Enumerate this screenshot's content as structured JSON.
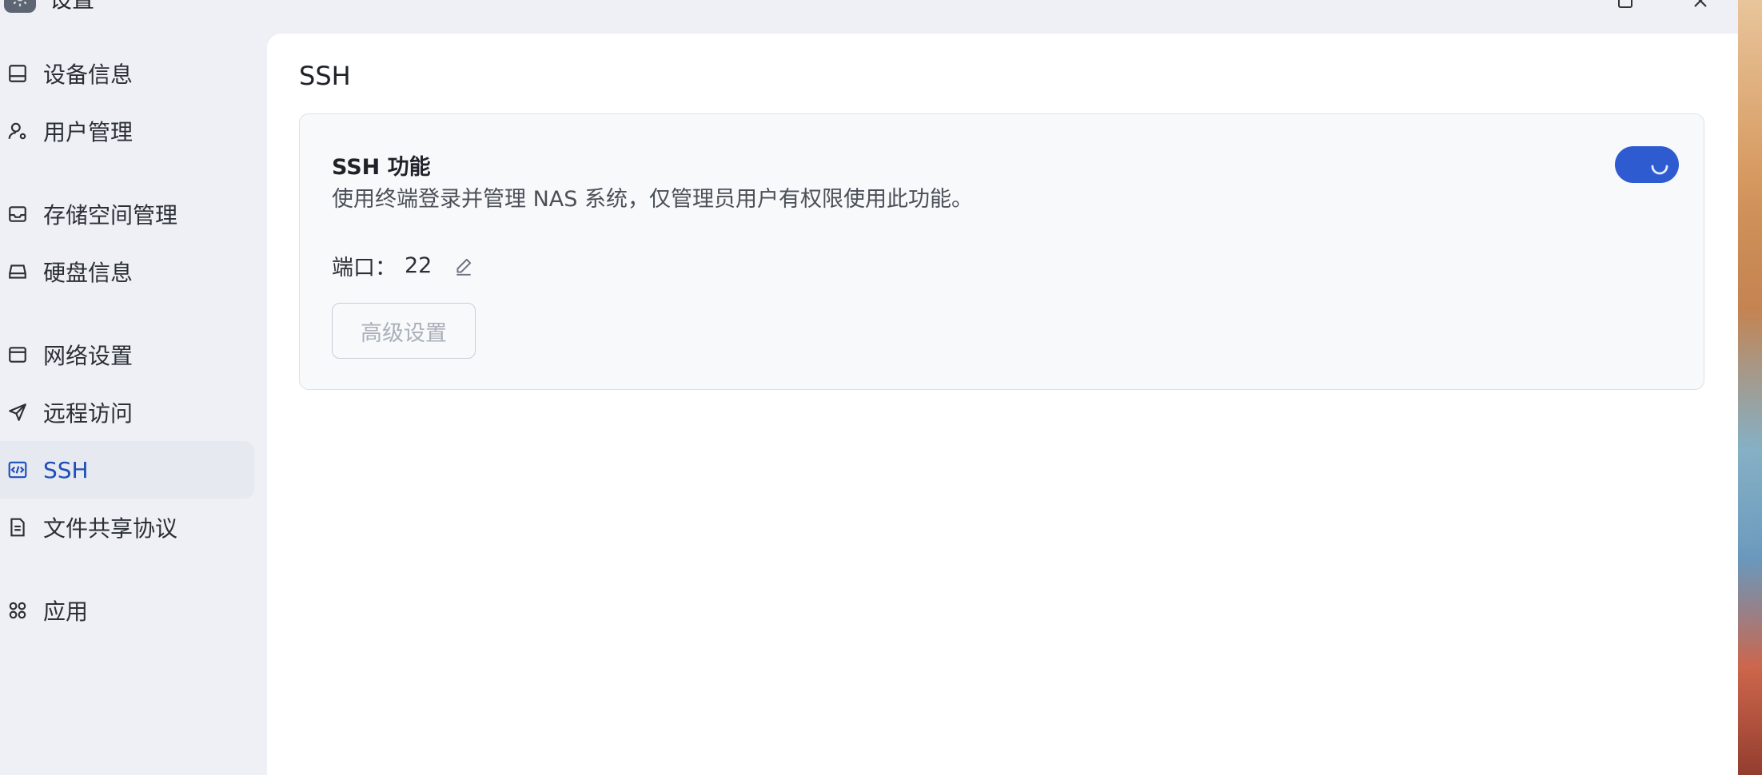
{
  "window": {
    "title": "设置",
    "app_icon": "gear-icon",
    "controls": [
      "maximize-icon",
      "close-icon"
    ]
  },
  "sidebar": {
    "items": [
      {
        "label": "设备信息",
        "icon": "device-icon",
        "active": false
      },
      {
        "label": "用户管理",
        "icon": "user-settings-icon",
        "active": false
      },
      {
        "label": "存储空间管理",
        "icon": "inbox-storage-icon",
        "active": false
      },
      {
        "label": "硬盘信息",
        "icon": "hard-disk-icon",
        "active": false
      },
      {
        "label": "网络设置",
        "icon": "network-icon",
        "active": false
      },
      {
        "label": "远程访问",
        "icon": "send-arrow-icon",
        "active": false
      },
      {
        "label": "SSH",
        "icon": "code-icon",
        "active": true
      },
      {
        "label": "文件共享协议",
        "icon": "document-icon",
        "active": false
      },
      {
        "label": "应用",
        "icon": "apps-grid-icon",
        "active": false
      }
    ]
  },
  "main": {
    "title": "SSH",
    "card": {
      "title": "SSH 功能",
      "description": "使用终端登录并管理 NAS 系统，仅管理员用户有权限使用此功能。",
      "toggle_on": true,
      "toggle_loading": true,
      "port_label": "端口：",
      "port_value": "22",
      "advanced_button": "高级设置",
      "advanced_disabled": true
    }
  },
  "colors": {
    "accent": "#2f5bd0",
    "active_text": "#1e4fb8",
    "sidebar_bg": "#eef0f5",
    "card_bg": "#f8f9fb"
  }
}
